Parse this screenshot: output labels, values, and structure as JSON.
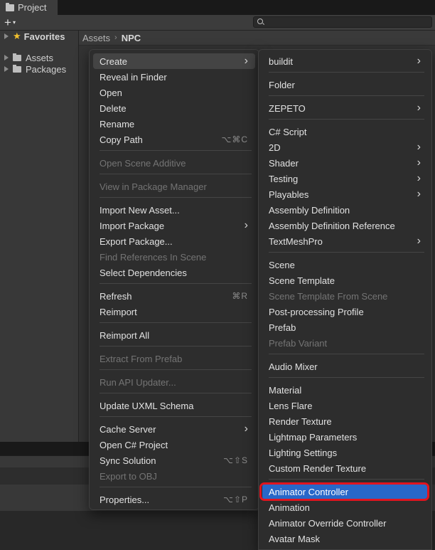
{
  "window": {
    "tab_title": "Project"
  },
  "toolbar": {
    "add_label": "+",
    "add_arrow": "▾",
    "search_icon": "search-icon"
  },
  "sidebar": {
    "favorites": "Favorites",
    "items": [
      "Assets",
      "Packages"
    ]
  },
  "breadcrumb": {
    "parent": "Assets",
    "separator": "›",
    "current": "NPC"
  },
  "context_menu": {
    "items": [
      {
        "label": "Create",
        "submenu": true,
        "shortcut": "",
        "state": "hover"
      },
      {
        "label": "Reveal in Finder",
        "shortcut": ""
      },
      {
        "label": "Open",
        "shortcut": ""
      },
      {
        "label": "Delete",
        "shortcut": ""
      },
      {
        "label": "Rename",
        "shortcut": ""
      },
      {
        "label": "Copy Path",
        "shortcut": "⌥⌘C"
      },
      {
        "label": "Open Scene Additive",
        "disabled": true
      },
      {
        "label": "View in Package Manager",
        "disabled": true
      },
      {
        "label": "Import New Asset..."
      },
      {
        "label": "Import Package",
        "submenu": true
      },
      {
        "label": "Export Package..."
      },
      {
        "label": "Find References In Scene",
        "disabled": true
      },
      {
        "label": "Select Dependencies"
      },
      {
        "label": "Refresh",
        "shortcut": "⌘R"
      },
      {
        "label": "Reimport"
      },
      {
        "label": "Reimport All"
      },
      {
        "label": "Extract From Prefab",
        "disabled": true
      },
      {
        "label": "Run API Updater...",
        "disabled": true
      },
      {
        "label": "Update UXML Schema"
      },
      {
        "label": "Cache Server",
        "submenu": true
      },
      {
        "label": "Open C# Project"
      },
      {
        "label": "Sync Solution",
        "shortcut": "⌥⇧S"
      },
      {
        "label": "Export to OBJ",
        "disabled": true
      },
      {
        "label": "Properties...",
        "shortcut": "⌥⇧P"
      }
    ]
  },
  "create_submenu": {
    "items": [
      {
        "label": "buildit",
        "submenu": true
      },
      {
        "label": "Folder"
      },
      {
        "label": "ZEPETO",
        "submenu": true
      },
      {
        "label": "C# Script"
      },
      {
        "label": "2D",
        "submenu": true
      },
      {
        "label": "Shader",
        "submenu": true
      },
      {
        "label": "Testing",
        "submenu": true
      },
      {
        "label": "Playables",
        "submenu": true
      },
      {
        "label": "Assembly Definition"
      },
      {
        "label": "Assembly Definition Reference"
      },
      {
        "label": "TextMeshPro",
        "submenu": true
      },
      {
        "label": "Scene"
      },
      {
        "label": "Scene Template"
      },
      {
        "label": "Scene Template From Scene",
        "disabled": true
      },
      {
        "label": "Post-processing Profile"
      },
      {
        "label": "Prefab"
      },
      {
        "label": "Prefab Variant",
        "disabled": true
      },
      {
        "label": "Audio Mixer"
      },
      {
        "label": "Material"
      },
      {
        "label": "Lens Flare"
      },
      {
        "label": "Render Texture"
      },
      {
        "label": "Lightmap Parameters"
      },
      {
        "label": "Lighting Settings"
      },
      {
        "label": "Custom Render Texture"
      },
      {
        "label": "Animator Controller",
        "state": "selected"
      },
      {
        "label": "Animation"
      },
      {
        "label": "Animator Override Controller"
      },
      {
        "label": "Avatar Mask"
      }
    ]
  },
  "colors": {
    "selection": "#2867c8",
    "highlight_ring": "#e0141f",
    "favorites_star": "#f2c12e"
  }
}
